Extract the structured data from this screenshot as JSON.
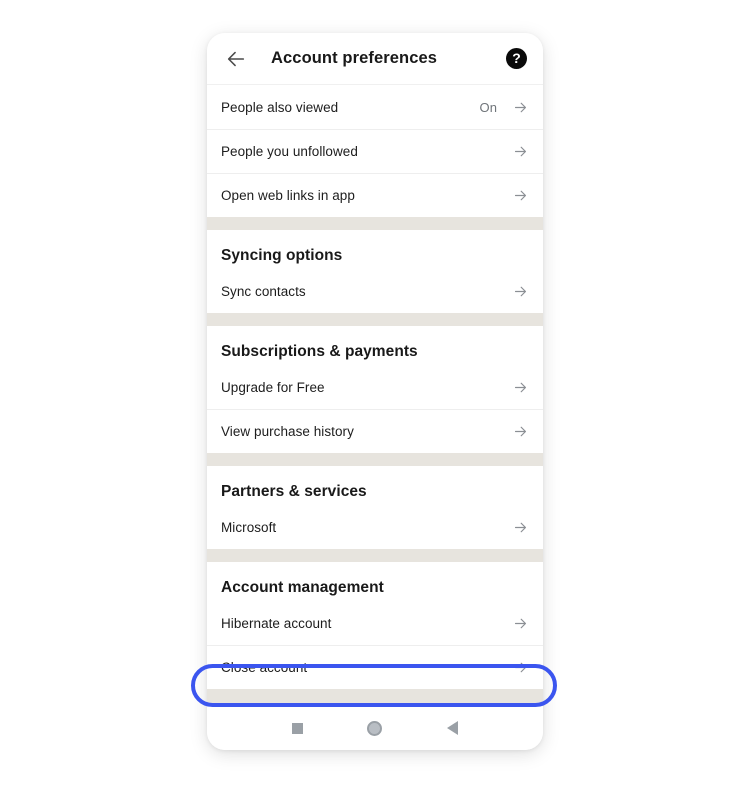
{
  "appbar": {
    "back_icon": "arrow-left-icon",
    "title": "Account preferences",
    "help_icon": "help-circle-icon",
    "help_glyph": "?"
  },
  "sections": [
    {
      "title": null,
      "rows": [
        {
          "label": "People also viewed",
          "value": "On",
          "arrow": "arrow-right-icon"
        },
        {
          "label": "People you unfollowed",
          "value": "",
          "arrow": "arrow-right-icon"
        },
        {
          "label": "Open web links in app",
          "value": "",
          "arrow": "arrow-right-icon"
        }
      ]
    },
    {
      "title": "Syncing options",
      "rows": [
        {
          "label": "Sync contacts",
          "value": "",
          "arrow": "arrow-right-icon"
        }
      ]
    },
    {
      "title": "Subscriptions & payments",
      "rows": [
        {
          "label": "Upgrade for Free",
          "value": "",
          "arrow": "arrow-right-icon"
        },
        {
          "label": "View purchase history",
          "value": "",
          "arrow": "arrow-right-icon"
        }
      ]
    },
    {
      "title": "Partners & services",
      "rows": [
        {
          "label": "Microsoft",
          "value": "",
          "arrow": "arrow-right-icon"
        }
      ]
    },
    {
      "title": "Account management",
      "rows": [
        {
          "label": "Hibernate account",
          "value": "",
          "arrow": "arrow-right-icon"
        },
        {
          "label": "Close account",
          "value": "",
          "arrow": "arrow-right-icon",
          "highlighted": true
        }
      ]
    }
  ],
  "navbar": {
    "recents_icon": "square-recents-icon",
    "home_icon": "circle-home-icon",
    "back_icon": "triangle-back-icon"
  },
  "annotation": {
    "target_label": "Close account",
    "ring_color": "#3b55ef"
  },
  "colors": {
    "accent": "#3b55ef",
    "section_gap": "#e7e4de",
    "card": "#ffffff",
    "primary_text": "#1d1d1d",
    "secondary_text": "#70757a",
    "divider": "#eeeeee",
    "nav_icon": "#9aa0a6"
  }
}
